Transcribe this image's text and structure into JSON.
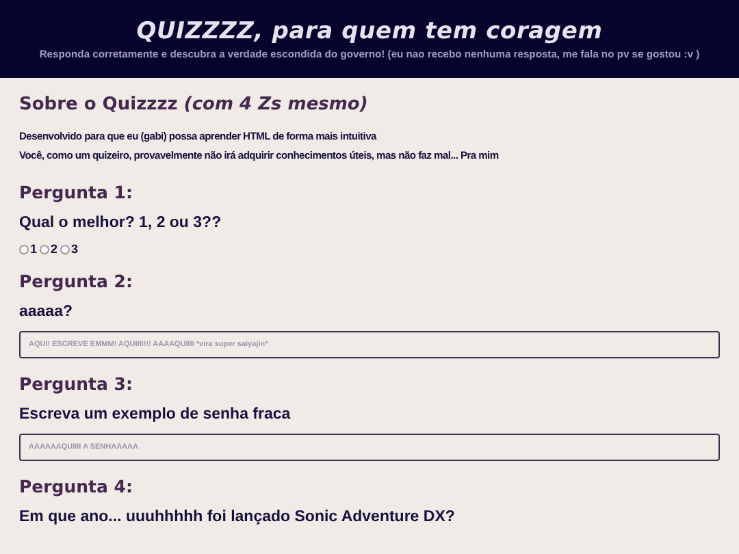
{
  "header": {
    "title": "QUIZZZZ, para quem tem coragem",
    "subtitle": "Responda corretamente e descubra a verdade escondida do governo! (eu nao recebo nenhuma resposta, me fala no pv se gostou :v )"
  },
  "about": {
    "heading": "Sobre o Quizzzz *(com 4 Zs mesmo)*",
    "paragraphs": [
      "Desenvolvido para que eu (gabi) possa aprender HTML de forma mais intuitiva",
      "Você, como um quizeiro, provavelmente não irá adquirir conhecimentos úteis, mas não faz mal... Pra mim"
    ]
  },
  "questions": [
    {
      "heading": "Pergunta 1:",
      "prompt": "Qual o melhor? 1, 2 ou 3??",
      "kind": "radio",
      "options": [
        {
          "label": "1",
          "selected": false
        },
        {
          "label": "2",
          "selected": false
        },
        {
          "label": "3",
          "selected": false
        }
      ]
    },
    {
      "heading": "Pergunta 2:",
      "prompt": "aaaaa?",
      "kind": "text",
      "placeholder": "AQUI! ESCREVE EMMM! AQUIIII!!! AAAAQUIIII *vira super saiyajin*"
    },
    {
      "heading": "Pergunta 3:",
      "prompt": "Escreva um exemplo de senha fraca",
      "kind": "text",
      "placeholder": "AAAAAAQUIIII A SENHAAAAA"
    },
    {
      "heading": "Pergunta 4:",
      "prompt": "Em que ano... uuuhhhhh foi lançado Sonic Adventure DX?",
      "kind": "none"
    }
  ]
}
